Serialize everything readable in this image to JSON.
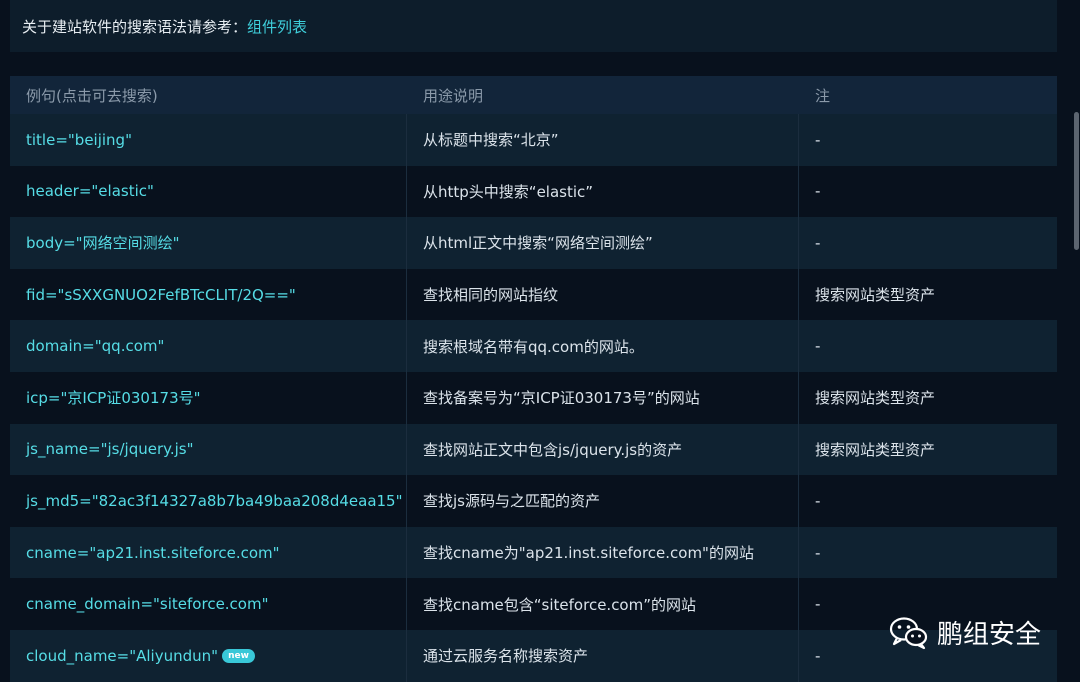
{
  "banner": {
    "text": "关于建站软件的搜索语法请参考：",
    "link": "组件列表"
  },
  "table": {
    "columns": [
      "例句(点击可去搜索)",
      "用途说明",
      "注"
    ],
    "rows": [
      {
        "query": "title=\"beijing\"",
        "desc": "从标题中搜索“北京”",
        "note": "-"
      },
      {
        "query": "header=\"elastic\"",
        "desc": "从http头中搜索“elastic”",
        "note": "-"
      },
      {
        "query": "body=\"网络空间测绘\"",
        "desc": "从html正文中搜索“网络空间测绘”",
        "note": "-"
      },
      {
        "query": "fid=\"sSXXGNUO2FefBTcCLIT/2Q==\"",
        "desc": "查找相同的网站指纹",
        "note": "搜索网站类型资产"
      },
      {
        "query": "domain=\"qq.com\"",
        "desc": "搜索根域名带有qq.com的网站。",
        "note": "-"
      },
      {
        "query": "icp=\"京ICP证030173号\"",
        "desc": "查找备案号为“京ICP证030173号”的网站",
        "note": "搜索网站类型资产"
      },
      {
        "query": "js_name=\"js/jquery.js\"",
        "desc": "查找网站正文中包含js/jquery.js的资产",
        "note": "搜索网站类型资产"
      },
      {
        "query": "js_md5=\"82ac3f14327a8b7ba49baa208d4eaa15\"",
        "desc": "查找js源码与之匹配的资产",
        "note": "-"
      },
      {
        "query": "cname=\"ap21.inst.siteforce.com\"",
        "desc": "查找cname为\"ap21.inst.siteforce.com\"的网站",
        "note": "-"
      },
      {
        "query": "cname_domain=\"siteforce.com\"",
        "desc": "查找cname包含“siteforce.com”的网站",
        "note": "-"
      },
      {
        "query": "cloud_name=\"Aliyundun\"",
        "desc": "通过云服务名称搜索资产",
        "note": "-",
        "badge": "new"
      }
    ]
  },
  "watermark": {
    "text": "鹏组安全",
    "icon": "wechat-icon"
  },
  "colors": {
    "background": "#08111d",
    "row_alt": "#0f2231",
    "accent": "#56dde6"
  }
}
